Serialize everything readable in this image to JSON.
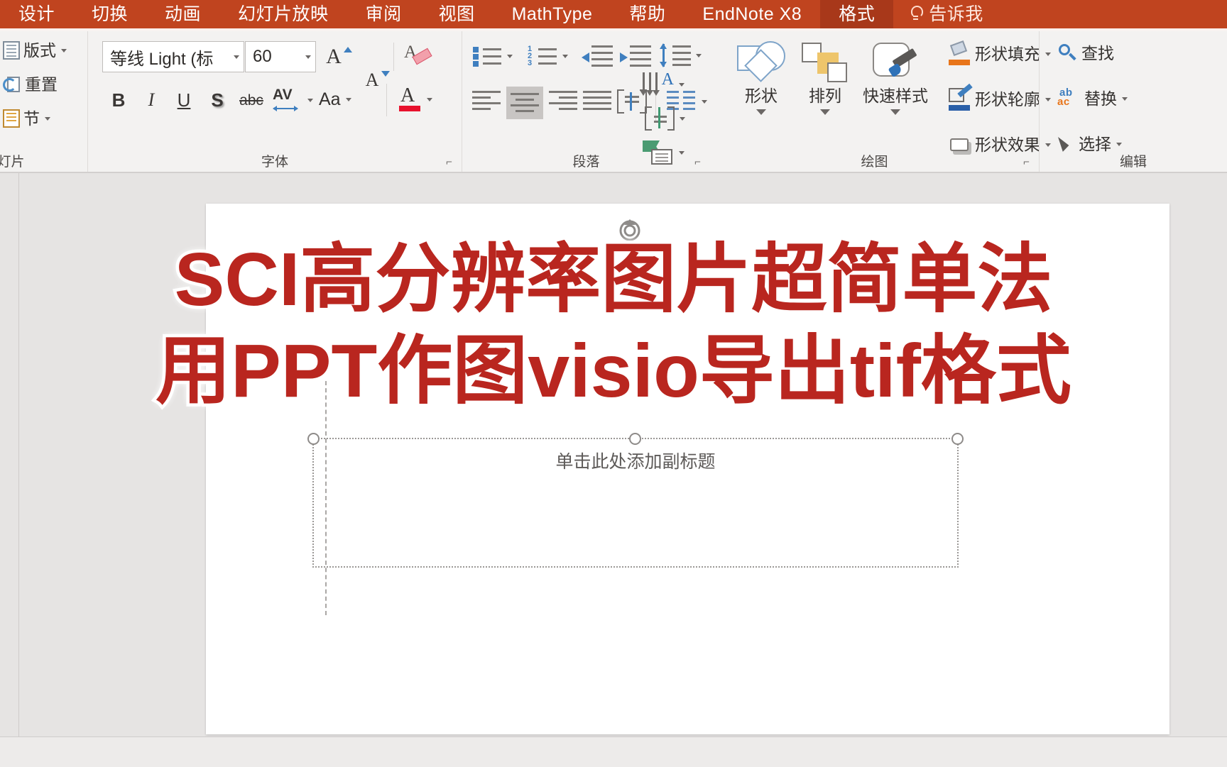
{
  "app": {
    "accent_color": "#c0441f",
    "active_tab_color": "#a8381a"
  },
  "ribbon_tabs": [
    {
      "label": "设计",
      "active": false
    },
    {
      "label": "切换",
      "active": false
    },
    {
      "label": "动画",
      "active": false
    },
    {
      "label": "幻灯片放映",
      "active": false
    },
    {
      "label": "审阅",
      "active": false
    },
    {
      "label": "视图",
      "active": false
    },
    {
      "label": "MathType",
      "active": false
    },
    {
      "label": "帮助",
      "active": false
    },
    {
      "label": "EndNote X8",
      "active": false
    },
    {
      "label": "格式",
      "active": true
    }
  ],
  "tell_me": {
    "label": "告诉我",
    "icon": "lightbulb-icon"
  },
  "groups": {
    "slides": {
      "label": "灯片",
      "items": [
        {
          "label": "版式",
          "icon": "layout-icon",
          "has_caret": true
        },
        {
          "label": "重置",
          "icon": "reset-icon",
          "has_caret": false
        },
        {
          "label": "节",
          "icon": "section-icon",
          "has_caret": true
        }
      ]
    },
    "font": {
      "label": "字体",
      "font_name": "等线 Light (标",
      "font_size": "60",
      "buttons": [
        {
          "name": "increase-font-size",
          "glyph": "A"
        },
        {
          "name": "decrease-font-size",
          "glyph": "A"
        },
        {
          "name": "clear-formatting",
          "glyph": "A"
        },
        {
          "name": "bold",
          "glyph": "B"
        },
        {
          "name": "italic",
          "glyph": "I"
        },
        {
          "name": "underline",
          "glyph": "U"
        },
        {
          "name": "text-shadow",
          "glyph": "S"
        },
        {
          "name": "strikethrough",
          "glyph": "abc"
        },
        {
          "name": "character-spacing",
          "glyph": "AV"
        },
        {
          "name": "change-case",
          "glyph": "Aa"
        },
        {
          "name": "font-color",
          "glyph": "A"
        }
      ]
    },
    "paragraph": {
      "label": "段落",
      "buttons": [
        {
          "name": "bullets"
        },
        {
          "name": "numbering"
        },
        {
          "name": "decrease-indent"
        },
        {
          "name": "increase-indent"
        },
        {
          "name": "line-spacing"
        },
        {
          "name": "text-direction"
        },
        {
          "name": "align-text"
        },
        {
          "name": "align-left"
        },
        {
          "name": "align-center",
          "selected": true
        },
        {
          "name": "align-right"
        },
        {
          "name": "justify"
        },
        {
          "name": "distribute"
        },
        {
          "name": "columns"
        },
        {
          "name": "convert-to-smartart"
        }
      ]
    },
    "drawing": {
      "label": "绘图",
      "big_buttons": [
        {
          "label": "形状",
          "icon": "shapes-icon"
        },
        {
          "label": "排列",
          "icon": "arrange-icon"
        },
        {
          "label": "快速样式",
          "icon": "quick-styles-icon"
        }
      ],
      "small_buttons": [
        {
          "label": "形状填充",
          "icon": "shape-fill-icon",
          "swatch": "#e8751a"
        },
        {
          "label": "形状轮廓",
          "icon": "shape-outline-icon",
          "swatch": "#2a5fa8"
        },
        {
          "label": "形状效果",
          "icon": "shape-effects-icon"
        }
      ]
    },
    "editing": {
      "label": "编辑",
      "items": [
        {
          "label": "查找",
          "icon": "search-icon"
        },
        {
          "label": "替换",
          "icon": "replace-icon"
        },
        {
          "label": "选择",
          "icon": "select-icon"
        }
      ]
    }
  },
  "slide": {
    "subtitle_placeholder": "单击此处添加副标题"
  },
  "overlay_title": {
    "color": "#b9261f",
    "lines": [
      "SCI高分辨率图片超简单法",
      "用PPT作图visio导出tif格式"
    ]
  }
}
